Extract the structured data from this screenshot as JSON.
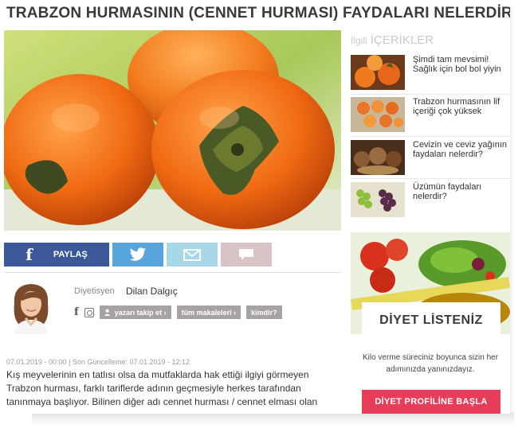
{
  "article": {
    "title": "TRABZON HURMASININ (CENNET HURMASI) FAYDALARI NELERDİR?",
    "meta": "07.01.2019 - 00:00 | Son Güncelleme: 07.01.2019 - 12:12",
    "body": "Kış meyvelerinin en tatlısı olsa da mutfaklarda hak ettiği ilgiyi görmeyen Trabzon hurması, farklı tariflerde adının geçmesiyle herkes tarafından tanınmaya başlıyor. Bilinen diğer adı cennet hurması / cennet elması olan"
  },
  "share": {
    "facebook_label": "PAYLAŞ",
    "facebook_icon": "facebook-icon",
    "twitter_icon": "twitter-icon",
    "mail_icon": "mail-icon",
    "comment_icon": "comment-icon",
    "colors": {
      "facebook": "#3b5998",
      "twitter": "#56a6dd",
      "mail": "#a8d8e8",
      "comment": "#d7c3c3"
    }
  },
  "author": {
    "role": "Diyetisyen",
    "name": "Dilan Dalgıç",
    "follow_label": "yazarı takip et ›",
    "articles_label": "tüm makaleleri ›",
    "who_label": "kimdir?"
  },
  "related": {
    "heading_small": "İlgili",
    "heading_big": "İÇERİKLER",
    "items": [
      {
        "title": "Şimdi tam mevsimi! Sağlık için bol bol yiyin"
      },
      {
        "title": "Trabzon hurmasının lif içeriği çok yüksek"
      },
      {
        "title": "Cevizin ve ceviz yağının faydaları nelerdir?"
      },
      {
        "title": "Üzümün faydaları nelerdir?"
      }
    ]
  },
  "ad": {
    "title": "DİYET LİSTENİZ",
    "text": "Kilo verme süreciniz boyunca sizin her adımınızda yanınızdayız.",
    "button": "DİYET PROFİLİNE BAŞLA",
    "accent": "#e63d5a"
  }
}
